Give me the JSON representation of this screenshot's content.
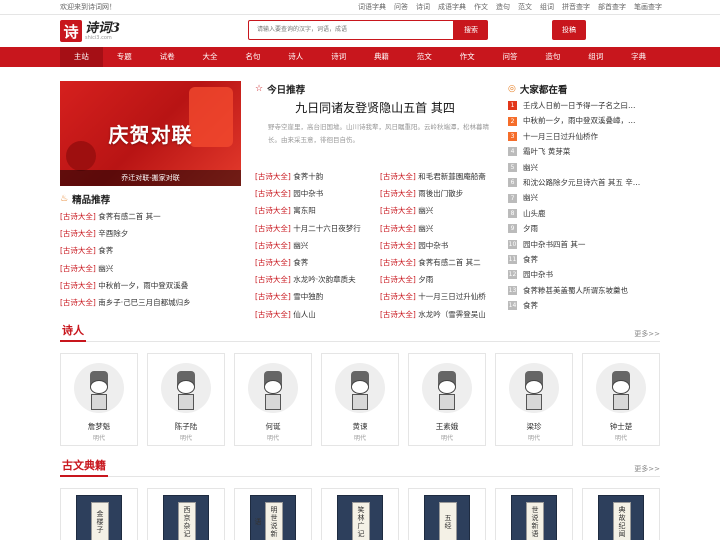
{
  "topbar": {
    "welcome": "欢迎来到诗词网！",
    "links": [
      "词语字典",
      "问答",
      "诗词",
      "成语字典",
      "作文",
      "造句",
      "范文",
      "组词",
      "拼音查字",
      "部首查字",
      "笔画查字"
    ]
  },
  "header": {
    "logo_char": "诗",
    "logo_text": "诗词3",
    "logo_sub": "shici3.com",
    "search_placeholder": "请输入要查询的汉字，词语，成语",
    "search_label": "搜索",
    "submit_label": "投稿"
  },
  "nav": [
    "主站",
    "专题",
    "试卷",
    "大全",
    "名句",
    "诗人",
    "诗词",
    "典籍",
    "范文",
    "作文",
    "问答",
    "造句",
    "组词",
    "字典"
  ],
  "banner": {
    "title": "庆贺对联",
    "caption": "乔迁对联-搬家对联"
  },
  "featured": {
    "title": "精品推荐",
    "items": [
      {
        "tag": "[古诗大全]",
        "text": "食荠有感二首 其一"
      },
      {
        "tag": "[古诗大全]",
        "text": "辛酉除夕"
      },
      {
        "tag": "[古诗大全]",
        "text": "食荠"
      },
      {
        "tag": "[古诗大全]",
        "text": "幽兴"
      },
      {
        "tag": "[古诗大全]",
        "text": "中秋前一夕，雨中登双溪叠"
      },
      {
        "tag": "[古诗大全]",
        "text": "南乡子·己巳三月自都城归乡"
      }
    ]
  },
  "today": {
    "section": "今日推荐",
    "title": "九日同诸友登贤隐山五首 其四",
    "text": "野寺空崖里，高台旧国墟。山川诗我辈，风日瞩重阳。云岭秋端潭，松林暮晴长。由来采玉意，徘徊目自伤。"
  },
  "grid_left": [
    {
      "tag": "[古诗大全]",
      "text": "食荠十韵"
    },
    {
      "tag": "[古诗大全]",
      "text": "园中杂书"
    },
    {
      "tag": "[古诗大全]",
      "text": "寓东阳"
    },
    {
      "tag": "[古诗大全]",
      "text": "十月二十六日夜梦行"
    },
    {
      "tag": "[古诗大全]",
      "text": "幽兴"
    },
    {
      "tag": "[古诗大全]",
      "text": "食荠"
    },
    {
      "tag": "[古诗大全]",
      "text": "水龙吟·次韵章质夫"
    },
    {
      "tag": "[古诗大全]",
      "text": "雪中独酌"
    },
    {
      "tag": "[古诗大全]",
      "text": "仙人山"
    }
  ],
  "grid_right": [
    {
      "tag": "[古诗大全]",
      "text": "和毛君新葺園庵船斋"
    },
    {
      "tag": "[古诗大全]",
      "text": "雨後出门散步"
    },
    {
      "tag": "[古诗大全]",
      "text": "幽兴"
    },
    {
      "tag": "[古诗大全]",
      "text": "幽兴"
    },
    {
      "tag": "[古诗大全]",
      "text": "园中杂书"
    },
    {
      "tag": "[古诗大全]",
      "text": "食荠有感二首 其二"
    },
    {
      "tag": "[古诗大全]",
      "text": "夕雨"
    },
    {
      "tag": "[古诗大全]",
      "text": "十一月三日过升仙桥"
    },
    {
      "tag": "[古诗大全]",
      "text": "水龙吟（雪霁登吴山"
    }
  ],
  "popular": {
    "title": "大家都在看",
    "items": [
      "壬戌人日前一日予得一子名之曰…",
      "中秋前一夕，雨中登双溪叠嶂，…",
      "十一月三日过升仙桥作",
      "霜叶飞 黄芽菜",
      "幽兴",
      "和沈公路除夕元旦诗六首 其五 辛…",
      "幽兴",
      "山头鹿",
      "夕雨",
      "园中杂书四首 其一",
      "食荠",
      "园中杂书",
      "食荠糁甚美盖蜀人所谓东坡羹也",
      "食荠"
    ]
  },
  "poets_section": {
    "title": "诗人",
    "more": "更多>>"
  },
  "poets": [
    {
      "name": "詹梦魁",
      "dynasty": "明代"
    },
    {
      "name": "陈子陆",
      "dynasty": "明代"
    },
    {
      "name": "何诞",
      "dynasty": "明代"
    },
    {
      "name": "黄谏",
      "dynasty": "明代"
    },
    {
      "name": "王素娥",
      "dynasty": "明代"
    },
    {
      "name": "梁珍",
      "dynasty": "明代"
    },
    {
      "name": "钟士楚",
      "dynasty": "明代"
    }
  ],
  "books_section": {
    "title": "古文典籍",
    "more": "更多>>"
  },
  "books": [
    "金楼子",
    "西京杂记",
    "明世说新语",
    "笑林广记",
    "五经",
    "世说新语",
    "典故纪闻"
  ]
}
